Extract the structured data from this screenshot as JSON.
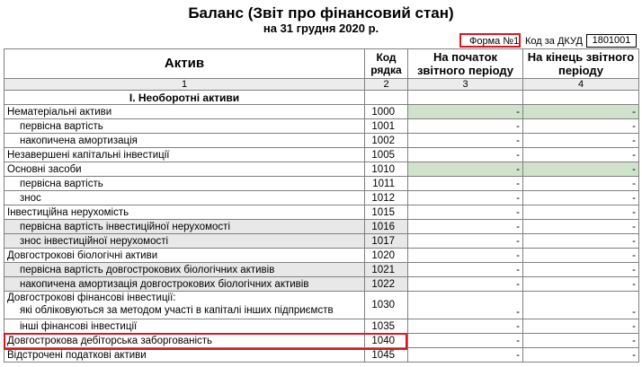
{
  "header": {
    "title": "Баланс (Звіт про фінансовий стан)",
    "subtitle": "на 31 грудня 2020 р.",
    "forma": "Форма №1",
    "dkud_label": "Код за ДКУД",
    "dkud_code": "1801001"
  },
  "table": {
    "col_headers": {
      "aktiv": "Актив",
      "kod": "Код рядка",
      "start": "На початок звітного періоду",
      "end": "На кінець звітного періоду"
    },
    "col_numbers": [
      "1",
      "2",
      "3",
      "4"
    ],
    "section_title": "І. Необоротні  активи",
    "rows": [
      {
        "label": "Нематеріальні активи",
        "code": "1000",
        "start": "-",
        "end": "-"
      },
      {
        "label": "первісна вартість",
        "code": "1001",
        "start": "-",
        "end": "-"
      },
      {
        "label": "накопичена амортизація",
        "code": "1002",
        "start": "-",
        "end": "-"
      },
      {
        "label": "Незавершені капітальні інвестиції",
        "code": "1005",
        "start": "-",
        "end": "-"
      },
      {
        "label": "Основні засоби",
        "code": "1010",
        "start": "-",
        "end": "-"
      },
      {
        "label": "первісна вартість",
        "code": "1011",
        "start": "-",
        "end": "-"
      },
      {
        "label": "знос",
        "code": "1012",
        "start": "-",
        "end": "-"
      },
      {
        "label": "Інвестиційна нерухомість",
        "code": "1015",
        "start": "-",
        "end": "-"
      },
      {
        "label": "первісна вартість інвестиційної нерухомості",
        "code": "1016",
        "start": "-",
        "end": "-"
      },
      {
        "label": "знос інвестиційної нерухомості",
        "code": "1017",
        "start": "-",
        "end": "-"
      },
      {
        "label": "Довгострокові біологічні активи",
        "code": "1020",
        "start": "-",
        "end": "-"
      },
      {
        "label": "первісна вартість довгострокових біологічних активів",
        "code": "1021",
        "start": "-",
        "end": "-"
      },
      {
        "label": "накопичена амортизація довгострокових біологічних активів",
        "code": "1022",
        "start": "-",
        "end": "-"
      },
      {
        "label": "Довгострокові фінансові інвестиції:",
        "label2": "які обліковуються за методом участі в капіталі інших підприємств",
        "code": "1030",
        "start": "-",
        "end": "-"
      },
      {
        "label": "інші фінансові інвестиції",
        "code": "1035",
        "start": "-",
        "end": "-"
      },
      {
        "label": "Довгострокова дебіторська заборгованість",
        "code": "1040",
        "start": "-",
        "end": "-"
      },
      {
        "label": "Відстрочені податкові активи",
        "code": "1045",
        "start": "-",
        "end": "-"
      }
    ]
  }
}
